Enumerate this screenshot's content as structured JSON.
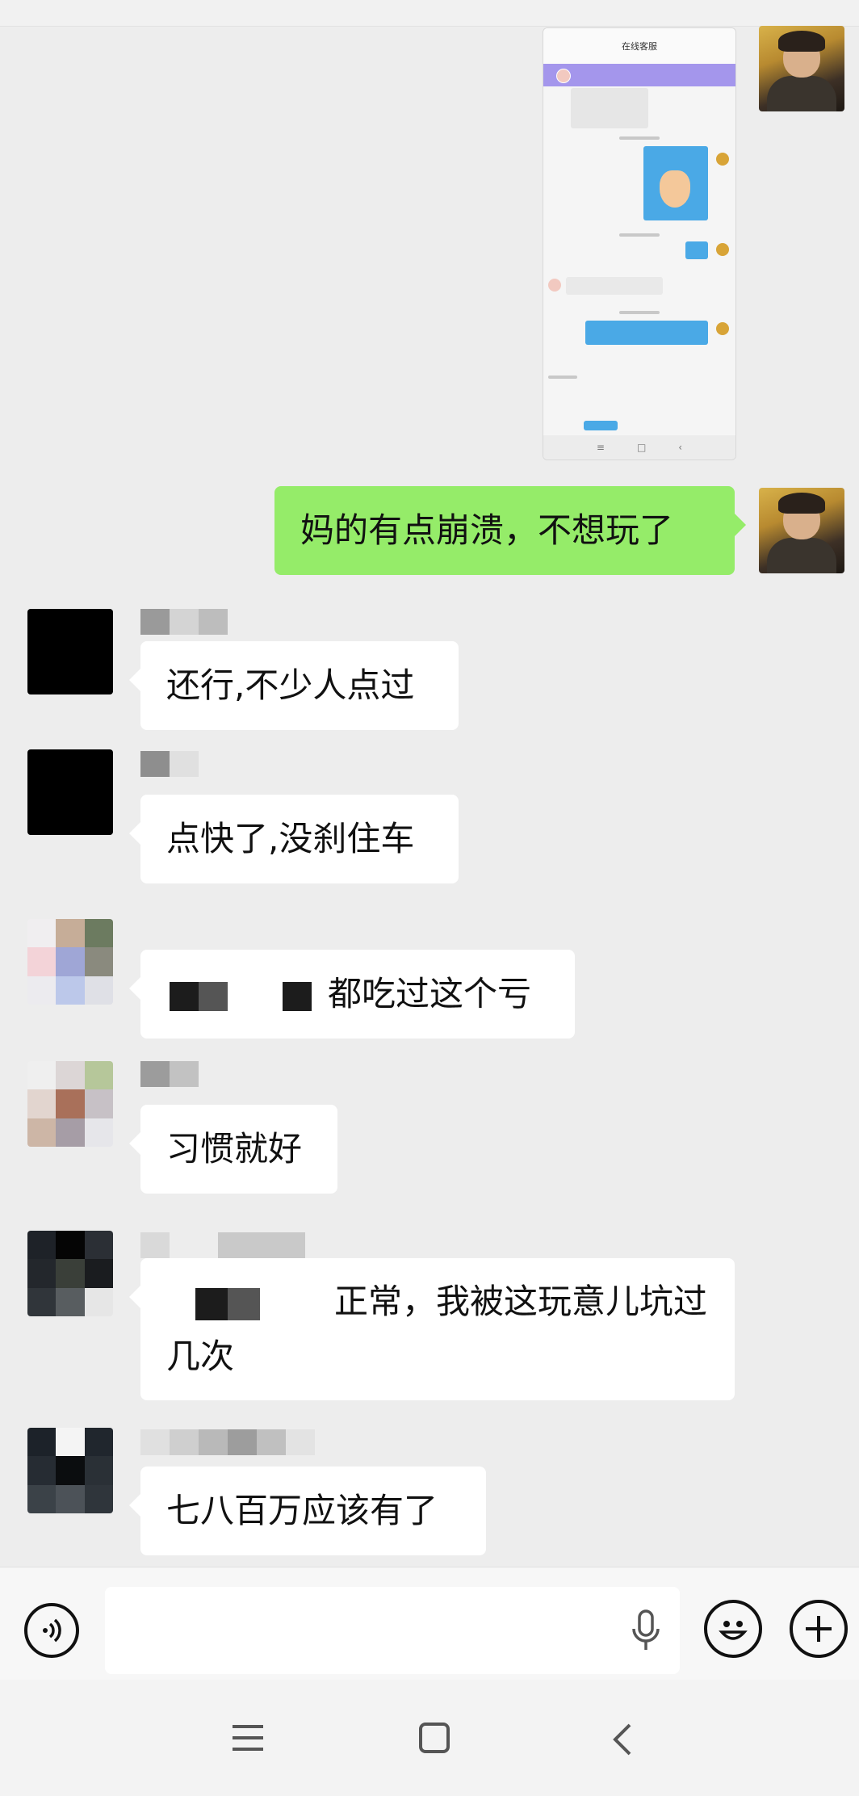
{
  "embedded_screenshot": {
    "title": "在线客服",
    "nav_buttons": [
      "≡",
      "□",
      "‹"
    ]
  },
  "messages": [
    {
      "side": "right",
      "text": "妈的有点崩溃，不想玩了"
    },
    {
      "side": "left",
      "text": "还行,不少人点过"
    },
    {
      "side": "left",
      "text": "点快了,没刹住车"
    },
    {
      "side": "left",
      "text": "都吃过这个亏"
    },
    {
      "side": "left",
      "text": "习惯就好"
    },
    {
      "side": "left",
      "text": "正常，我被这玩意儿坑过几次"
    },
    {
      "side": "left",
      "text": "七八百万应该有了"
    }
  ],
  "input_bar": {
    "voice_icon": "voice-toggle-icon",
    "mic_icon": "microphone-icon",
    "emoji_icon": "emoji-icon",
    "plus_icon": "plus-icon"
  },
  "system_nav": {
    "menu_icon": "menu-icon",
    "home_icon": "home-square-icon",
    "back_icon": "back-chevron-icon"
  },
  "colors": {
    "chat_bg": "#ededed",
    "self_bubble": "#95ec69",
    "other_bubble": "#ffffff"
  }
}
